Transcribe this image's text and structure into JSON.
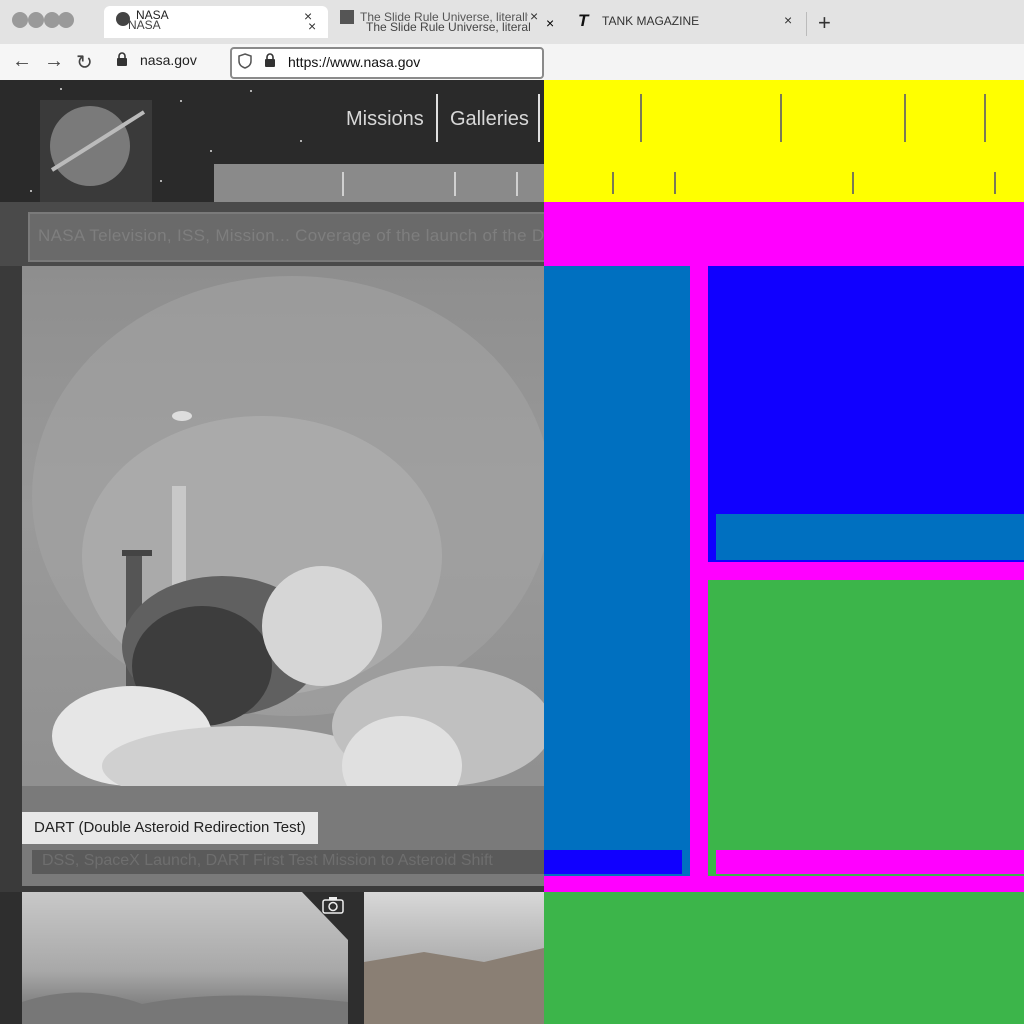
{
  "browser": {
    "tabs": [
      {
        "title": "NASA",
        "title_ghost": "NASA"
      },
      {
        "title": "The Slide Rule Universe, literally",
        "title_ghost": "The Slide Rule Universe, literal"
      },
      {
        "title": "TANK MAGAZINE"
      }
    ],
    "new_tab_label": "+",
    "close_glyph": "×",
    "url_short": "nasa.gov",
    "url_full": "https://www.nasa.gov"
  },
  "site": {
    "nav": [
      "Missions",
      "Galleries"
    ],
    "ticker_text": "NASA Television, ISS, Mission... Coverage of the launch of the Double...",
    "hero_caption": "DART (Double Asteroid Redirection Test)",
    "hero_subtext": "DSS, SpaceX Launch, DART First Test Mission to Asteroid Shift"
  },
  "colors": {
    "yellow": "#ffff00",
    "magenta": "#ff00ff",
    "blue_steel": "#0070c0",
    "blue_bright": "#1000ff",
    "green": "#3cb54a",
    "gray_tick": "#7a7a55"
  },
  "icons": {
    "back": "back-arrow-icon",
    "forward": "forward-arrow-icon",
    "reload": "reload-icon",
    "lock": "lock-icon",
    "shield": "shield-icon",
    "camera": "camera-icon"
  }
}
